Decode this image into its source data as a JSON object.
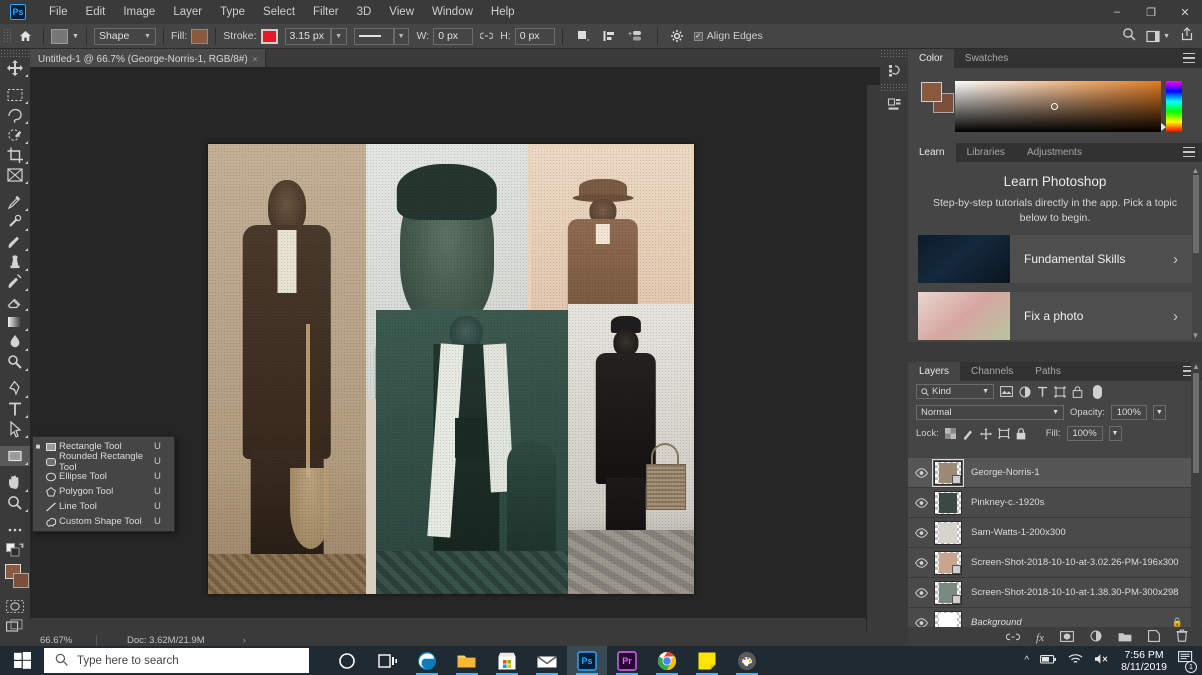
{
  "menubar": {
    "logo": "Ps",
    "items": [
      "File",
      "Edit",
      "Image",
      "Layer",
      "Type",
      "Select",
      "Filter",
      "3D",
      "View",
      "Window",
      "Help"
    ],
    "window_controls": [
      "minimize",
      "maximize",
      "close"
    ]
  },
  "options_bar": {
    "home_icon": "home-icon",
    "shape_preset_label": "",
    "mode": "Shape",
    "fill_label": "Fill:",
    "fill_color": "#8b5a3c",
    "stroke_label": "Stroke:",
    "stroke_color": "#e8182a",
    "stroke_width": "3.15 px",
    "stroke_style": "solid",
    "w_label": "W:",
    "w_value": "0 px",
    "link_icon": "link-icon",
    "h_label": "H:",
    "h_value": "0 px",
    "path_ops_icon": "path-operations-icon",
    "path_align_icon": "path-alignment-icon",
    "path_arrange_icon": "path-arrangement-icon",
    "gear_icon": "gear-icon",
    "align_edges_checked": true,
    "align_edges_label": "Align Edges"
  },
  "toolbar": {
    "tools": [
      {
        "name": "move-tool",
        "icon": "move"
      },
      {
        "name": "rectangular-marquee-tool",
        "icon": "marquee"
      },
      {
        "name": "lasso-tool",
        "icon": "lasso"
      },
      {
        "name": "object-selection-tool",
        "icon": "quickselect"
      },
      {
        "name": "crop-tool",
        "icon": "crop"
      },
      {
        "name": "frame-tool",
        "icon": "frame"
      },
      {
        "name": "eyedropper-tool",
        "icon": "eyedropper"
      },
      {
        "name": "spot-healing-brush-tool",
        "icon": "healing"
      },
      {
        "name": "brush-tool",
        "icon": "brush"
      },
      {
        "name": "clone-stamp-tool",
        "icon": "stamp"
      },
      {
        "name": "history-brush-tool",
        "icon": "historybrush"
      },
      {
        "name": "eraser-tool",
        "icon": "eraser"
      },
      {
        "name": "gradient-tool",
        "icon": "gradient"
      },
      {
        "name": "blur-tool",
        "icon": "blur"
      },
      {
        "name": "dodge-tool",
        "icon": "dodge"
      },
      {
        "name": "pen-tool",
        "icon": "pen"
      },
      {
        "name": "horizontal-type-tool",
        "icon": "type"
      },
      {
        "name": "path-selection-tool",
        "icon": "pathselect"
      },
      {
        "name": "rectangle-tool",
        "icon": "rectangle",
        "selected": true
      },
      {
        "name": "hand-tool",
        "icon": "hand"
      },
      {
        "name": "zoom-tool",
        "icon": "zoom"
      },
      {
        "name": "edit-toolbar-tool",
        "icon": "ellipsis"
      }
    ],
    "foreground_color": "#8b5a3c",
    "background_color": "#7a4e38",
    "quick-mask-icon": "quick-mask-icon",
    "screen-mode-icon": "screen-mode-icon"
  },
  "shape_flyout": {
    "items": [
      {
        "label": "Rectangle Tool",
        "shortcut": "U",
        "icon": "rectangle-icon",
        "selected": true
      },
      {
        "label": "Rounded Rectangle Tool",
        "shortcut": "U",
        "icon": "rounded-rectangle-icon"
      },
      {
        "label": "Ellipse Tool",
        "shortcut": "U",
        "icon": "ellipse-icon"
      },
      {
        "label": "Polygon Tool",
        "shortcut": "U",
        "icon": "polygon-icon"
      },
      {
        "label": "Line Tool",
        "shortcut": "U",
        "icon": "line-icon"
      },
      {
        "label": "Custom Shape Tool",
        "shortcut": "U",
        "icon": "custom-shape-icon"
      }
    ]
  },
  "document": {
    "tab_title": "Untitled-1 @ 66.7% (George-Norris-1, RGB/8#)",
    "tab_modified_marker": "*",
    "tab_close": "×"
  },
  "status_bar": {
    "zoom": "66.67%",
    "doc_info": "Doc: 3.62M/21.9M",
    "expand_arrow": "›"
  },
  "right_icon_dock": {
    "items": [
      {
        "name": "history-panel-icon"
      },
      {
        "name": "properties-panel-icon"
      }
    ]
  },
  "color_panel": {
    "tabs": [
      {
        "label": "Color",
        "active": true
      },
      {
        "label": "Swatches",
        "active": false
      }
    ],
    "foreground": "#8b5a3c",
    "background": "#7a4e38",
    "ramp_hue": "#e07b24",
    "picker_marker": "circle-marker",
    "menu_icon": "panel-menu-icon"
  },
  "learn_panel": {
    "tabs": [
      {
        "label": "Learn",
        "active": true
      },
      {
        "label": "Libraries",
        "active": false
      },
      {
        "label": "Adjustments",
        "active": false
      }
    ],
    "heading": "Learn Photoshop",
    "subheading": "Step-by-step tutorials directly in the app. Pick a topic below to begin.",
    "tutorials": [
      {
        "label": "Fundamental Skills",
        "chevron": "›",
        "thumb": "dark-room-thumbnail"
      },
      {
        "label": "Fix a photo",
        "chevron": "›",
        "thumb": "flowers-thumbnail"
      }
    ],
    "menu_icon": "panel-menu-icon"
  },
  "layers_panel": {
    "tabs": [
      {
        "label": "Layers",
        "active": true
      },
      {
        "label": "Channels",
        "active": false
      },
      {
        "label": "Paths",
        "active": false
      }
    ],
    "filter_label": "Kind",
    "filter_icons": [
      "pixel-filter-icon",
      "adjustment-filter-icon",
      "type-filter-icon",
      "shape-filter-icon",
      "smart-object-filter-icon"
    ],
    "filter_toggle": "filter-enable-toggle",
    "blend_mode": "Normal",
    "opacity_label": "Opacity:",
    "opacity_value": "100%",
    "lock_label": "Lock:",
    "lock_icons": [
      "lock-transparent-pixels-icon",
      "lock-image-pixels-icon",
      "lock-position-icon",
      "lock-artboard-nesting-icon",
      "lock-all-icon"
    ],
    "fill_label": "Fill:",
    "fill_value": "100%",
    "layers": [
      {
        "name": "George-Norris-1",
        "visible": true,
        "active": true,
        "smart_object": true,
        "thumb": "#9b8a74"
      },
      {
        "name": "Pinkney-c.-1920s",
        "visible": true,
        "active": false,
        "smart_object": false,
        "thumb": "#3a4a42"
      },
      {
        "name": "Sam-Watts-1-200x300",
        "visible": true,
        "active": false,
        "smart_object": false,
        "thumb": "#d7d4cd"
      },
      {
        "name": "Screen-Shot-2018-10-10-at-3.02.26-PM-196x300",
        "visible": true,
        "active": false,
        "smart_object": true,
        "thumb": "#c8a58c"
      },
      {
        "name": "Screen-Shot-2018-10-10-at-1.38.30-PM-300x298",
        "visible": true,
        "active": false,
        "smart_object": true,
        "thumb": "#7a8a80"
      },
      {
        "name": "Background",
        "visible": true,
        "active": false,
        "locked": true,
        "italic": true,
        "thumb": "#ffffff"
      }
    ],
    "footer_icons": [
      "link-layers-icon",
      "add-layer-style-icon",
      "add-layer-mask-icon",
      "new-adjustment-layer-icon",
      "new-group-icon",
      "new-layer-icon",
      "delete-layer-icon"
    ]
  },
  "canvas": {
    "photos": [
      {
        "name": "photo-left-man-with-broom",
        "tone": "#b9a78d"
      },
      {
        "name": "photo-center-portrait",
        "tone": "#cfd6cc"
      },
      {
        "name": "photo-top-right-man-with-hat",
        "tone": "#e0c4ad"
      },
      {
        "name": "photo-center-bottom-man-with-apron",
        "tone": "#2e4b44"
      },
      {
        "name": "photo-bottom-right-man-with-basket",
        "tone": "#d8d8d4"
      }
    ]
  },
  "taskbar": {
    "start_icon": "windows-start-icon",
    "search_placeholder": "Type here to search",
    "search_icon": "search-icon",
    "items": [
      {
        "name": "cortana-icon"
      },
      {
        "name": "task-view-icon"
      },
      {
        "name": "microsoft-edge-icon",
        "running": true
      },
      {
        "name": "file-explorer-icon",
        "running": true
      },
      {
        "name": "microsoft-store-icon",
        "running": true
      },
      {
        "name": "mail-icon",
        "running": true
      },
      {
        "name": "photoshop-icon",
        "active": true,
        "label": "Ps"
      },
      {
        "name": "premiere-pro-icon",
        "running": true,
        "label": "Pr"
      },
      {
        "name": "google-chrome-icon",
        "running": true
      },
      {
        "name": "sticky-notes-icon",
        "running": true
      },
      {
        "name": "paint-3d-icon",
        "running": true
      }
    ],
    "tray": {
      "show_hidden_icon": "chevron-up-icon",
      "battery_icon": "battery-icon",
      "wifi_icon": "wifi-icon",
      "volume_icon": "volume-muted-icon",
      "time": "7:56 PM",
      "date": "8/11/2019",
      "notifications_icon": "action-center-icon",
      "notification_count": "1"
    }
  }
}
